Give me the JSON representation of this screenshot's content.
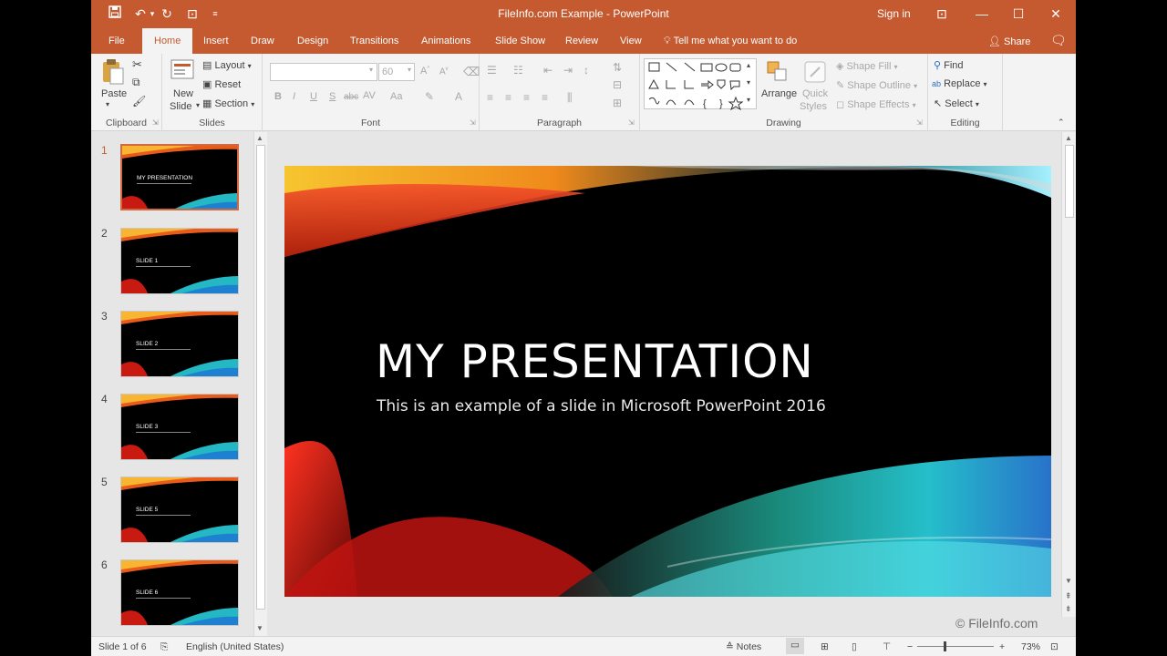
{
  "window": {
    "title": "FileInfo.com Example  -  PowerPoint",
    "sign_in": "Sign in",
    "accent": "#c55a30"
  },
  "qat": {
    "save_icon": "save-icon",
    "undo_icon": "undo-icon",
    "redo_icon": "redo-icon"
  },
  "tabs": [
    "File",
    "Home",
    "Insert",
    "Draw",
    "Design",
    "Transitions",
    "Animations",
    "Slide Show",
    "Review",
    "View"
  ],
  "active_tab": "Home",
  "tell_me": "Tell me what you want to do",
  "share": "Share",
  "ribbon": {
    "clipboard": {
      "label": "Clipboard",
      "paste": "Paste"
    },
    "slides": {
      "label": "Slides",
      "new_slide": "New",
      "new_slide2": "Slide",
      "layout": "Layout",
      "reset": "Reset",
      "section": "Section"
    },
    "font": {
      "label": "Font",
      "size": "60",
      "buttons": [
        "B",
        "I",
        "U",
        "S",
        "abc",
        "AV",
        "Aa"
      ]
    },
    "paragraph": {
      "label": "Paragraph"
    },
    "drawing": {
      "label": "Drawing",
      "arrange": "Arrange",
      "quick": "Quick",
      "styles": "Styles",
      "shape_fill": "Shape Fill",
      "shape_outline": "Shape Outline",
      "shape_effects": "Shape Effects"
    },
    "editing": {
      "label": "Editing",
      "find": "Find",
      "replace": "Replace",
      "select": "Select"
    }
  },
  "thumbnails": [
    {
      "num": "1",
      "title": "MY PRESENTATION",
      "selected": true
    },
    {
      "num": "2",
      "title": "SLIDE 1",
      "selected": false
    },
    {
      "num": "3",
      "title": "SLIDE 2",
      "selected": false
    },
    {
      "num": "4",
      "title": "SLIDE 3",
      "selected": false
    },
    {
      "num": "5",
      "title": "SLIDE 5",
      "selected": false
    },
    {
      "num": "6",
      "title": "SLIDE 6",
      "selected": false
    }
  ],
  "slide": {
    "title": "MY PRESENTATION",
    "subtitle": "This is an example of a slide in Microsoft PowerPoint 2016"
  },
  "watermark": "© FileInfo.com",
  "status": {
    "slide_of": "Slide 1 of 6",
    "language": "English (United States)",
    "notes": "Notes",
    "zoom": "73%"
  }
}
